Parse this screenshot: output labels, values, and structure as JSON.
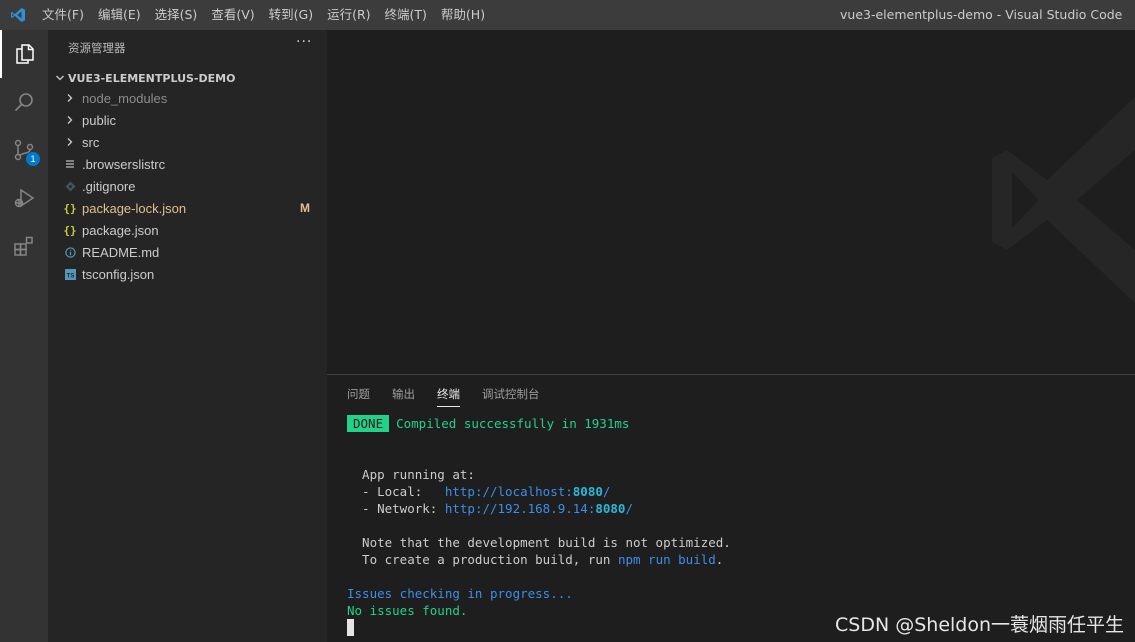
{
  "menu": [
    "文件(F)",
    "编辑(E)",
    "选择(S)",
    "查看(V)",
    "转到(G)",
    "运行(R)",
    "终端(T)",
    "帮助(H)"
  ],
  "window_title": "vue3-elementplus-demo - Visual Studio Code",
  "activity": {
    "scm_badge": "1"
  },
  "sidebar": {
    "header": "资源管理器",
    "more": "···",
    "folder": "VUE3-ELEMENTPLUS-DEMO",
    "items": [
      {
        "label": "node_modules",
        "icon": "chevron-right-icon"
      },
      {
        "label": "public",
        "icon": "chevron-right-icon"
      },
      {
        "label": "src",
        "icon": "chevron-right-icon"
      },
      {
        "label": ".browserslistrc",
        "icon": "lines-file-icon"
      },
      {
        "label": ".gitignore",
        "icon": "git-diamond-icon"
      },
      {
        "label": "package-lock.json",
        "icon": "json-braces-icon",
        "decoration": "M"
      },
      {
        "label": "package.json",
        "icon": "json-braces-icon"
      },
      {
        "label": "README.md",
        "icon": "info-icon"
      },
      {
        "label": "tsconfig.json",
        "icon": "ts-file-icon"
      }
    ]
  },
  "panel": {
    "tabs": [
      "问题",
      "输出",
      "终端",
      "调试控制台"
    ],
    "active_tab": "终端"
  },
  "terminal": {
    "done": "DONE",
    "compiled": "Compiled successfully in 1931ms",
    "app_running": "  App running at:",
    "local_label": "  - Local:   ",
    "local_url_a": "http://localhost:",
    "local_port": "8080",
    "local_url_b": "/",
    "network_label": "  - Network: ",
    "network_url_a": "http://192.168.9.14:",
    "network_port": "8080",
    "network_url_b": "/",
    "note1": "  Note that the development build is not optimized.",
    "note2a": "  To create a production build, run ",
    "note2cmd": "npm run build",
    "note2b": ".",
    "issues": "Issues checking in progress...",
    "no_issues": "No issues found."
  },
  "watermark_text": "CSDN @Sheldon一蓑烟雨任平生",
  "colors": {
    "accent": "#007acc",
    "modified": "#e2c08d",
    "terminal_green": "#23d18b",
    "terminal_blue": "#3b8eea"
  }
}
